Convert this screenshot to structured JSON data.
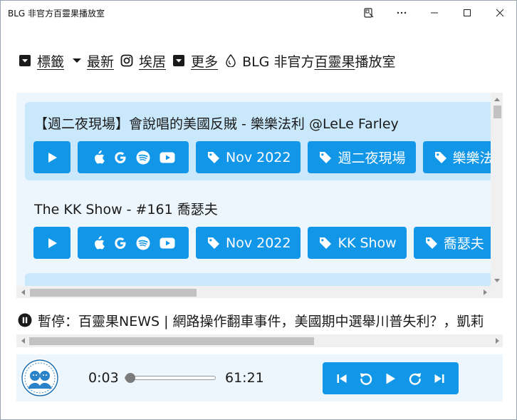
{
  "window": {
    "title": "BLG 非官方百靈果播放室"
  },
  "nav": {
    "tags_label": "標籤",
    "latest_label": "最新",
    "instagram_label": "埃居",
    "more_label": "更多",
    "site_prefix": "BLG 非官方",
    "site_link": "百靈果",
    "site_suffix": "播放室"
  },
  "episodes": [
    {
      "title": "【週二夜現場】會說唱的美國反賊 - 樂樂法利 @LeLe Farley",
      "tags": [
        "Nov 2022",
        "週二夜現場",
        "樂樂法利"
      ]
    },
    {
      "title": "The KK Show - #161 喬瑟夫",
      "tags": [
        "Nov 2022",
        "KK Show",
        "喬瑟夫"
      ]
    }
  ],
  "now_playing": {
    "text": "暫停：百靈果NEWS | 網路操作翻車事件，美國期中選舉川普失利？，凱莉"
  },
  "player": {
    "current_time": "0:03",
    "total_time": "61:21",
    "progress": 0.001
  },
  "colors": {
    "accent": "#1296e8",
    "card_highlight": "#c9e8fb",
    "panel_bg": "#edf6fc"
  },
  "icons": {
    "platforms": [
      "apple-icon",
      "google-icon",
      "spotify-icon",
      "youtube-icon"
    ],
    "tag": "tag-icon",
    "controls": [
      "skip-back-icon",
      "rewind-icon",
      "play-icon",
      "forward-icon",
      "skip-forward-icon"
    ]
  }
}
